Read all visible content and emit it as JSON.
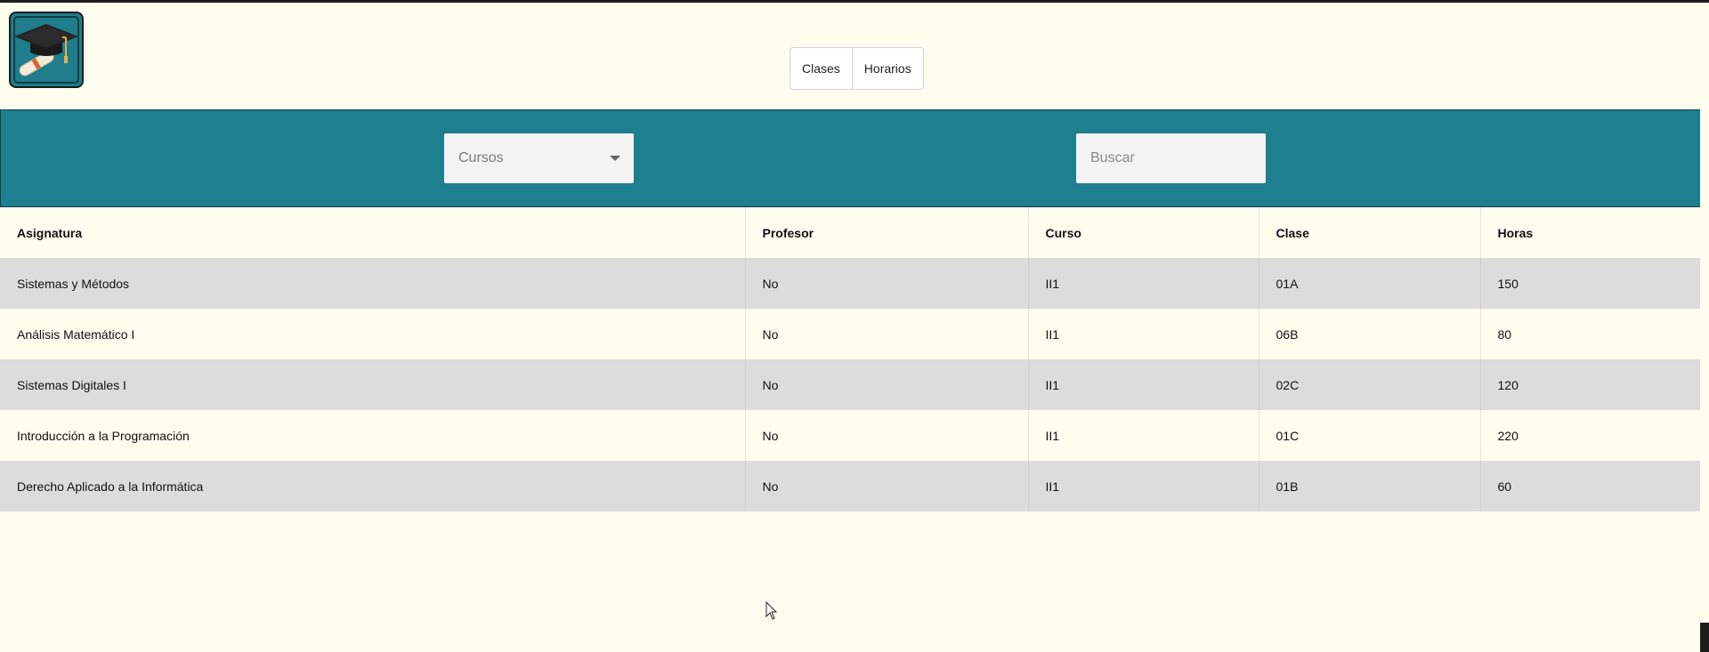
{
  "logo": {
    "icon": "graduation-cap-icon"
  },
  "nav": {
    "items": [
      {
        "label": "Clases"
      },
      {
        "label": "Horarios"
      }
    ]
  },
  "filters": {
    "course_select": {
      "placeholder": "Cursos"
    },
    "search": {
      "placeholder": "Buscar",
      "value": ""
    }
  },
  "table": {
    "headers": [
      "Asignatura",
      "Profesor",
      "Curso",
      "Clase",
      "Horas"
    ],
    "rows": [
      [
        "Sistemas y Métodos",
        "No",
        "II1",
        "01A",
        "150"
      ],
      [
        "Análisis Matemático I",
        "No",
        "II1",
        "06B",
        "80"
      ],
      [
        "Sistemas Digitales I",
        "No",
        "II1",
        "02C",
        "120"
      ],
      [
        "Introducción a la Programación",
        "No",
        "II1",
        "01C",
        "220"
      ],
      [
        "Derecho Aplicado a la Informática",
        "No",
        "II1",
        "01B",
        "60"
      ]
    ]
  },
  "colors": {
    "accent": "#1e7f8f",
    "background": "#fdfeee",
    "row_stripe": "#dcdcdc"
  }
}
